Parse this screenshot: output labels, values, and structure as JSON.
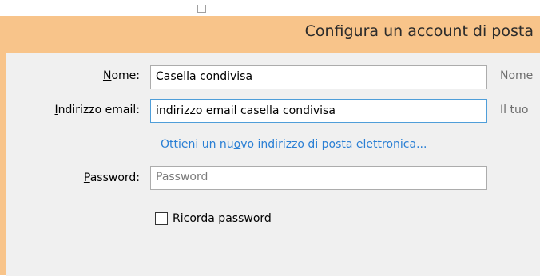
{
  "dialog": {
    "title": "Configura un account di posta"
  },
  "form": {
    "name": {
      "label_pre": "",
      "label_u": "N",
      "label_post": "ome:",
      "value": "Casella condivisa",
      "hint": "Nome"
    },
    "email": {
      "label_pre": "",
      "label_u": "I",
      "label_post": "ndirizzo email:",
      "value": "indirizzo email casella condivisa",
      "hint": "Il tuo"
    },
    "new_address_link": {
      "pre": "Ottieni un nu",
      "u": "o",
      "post": "vo indirizzo di posta elettronica..."
    },
    "password": {
      "label_pre": "",
      "label_u": "P",
      "label_post": "assword:",
      "value": "",
      "placeholder": "Password"
    },
    "remember": {
      "label_pre": "Ricorda pass",
      "label_u": "w",
      "label_post": "ord",
      "checked": false
    }
  }
}
